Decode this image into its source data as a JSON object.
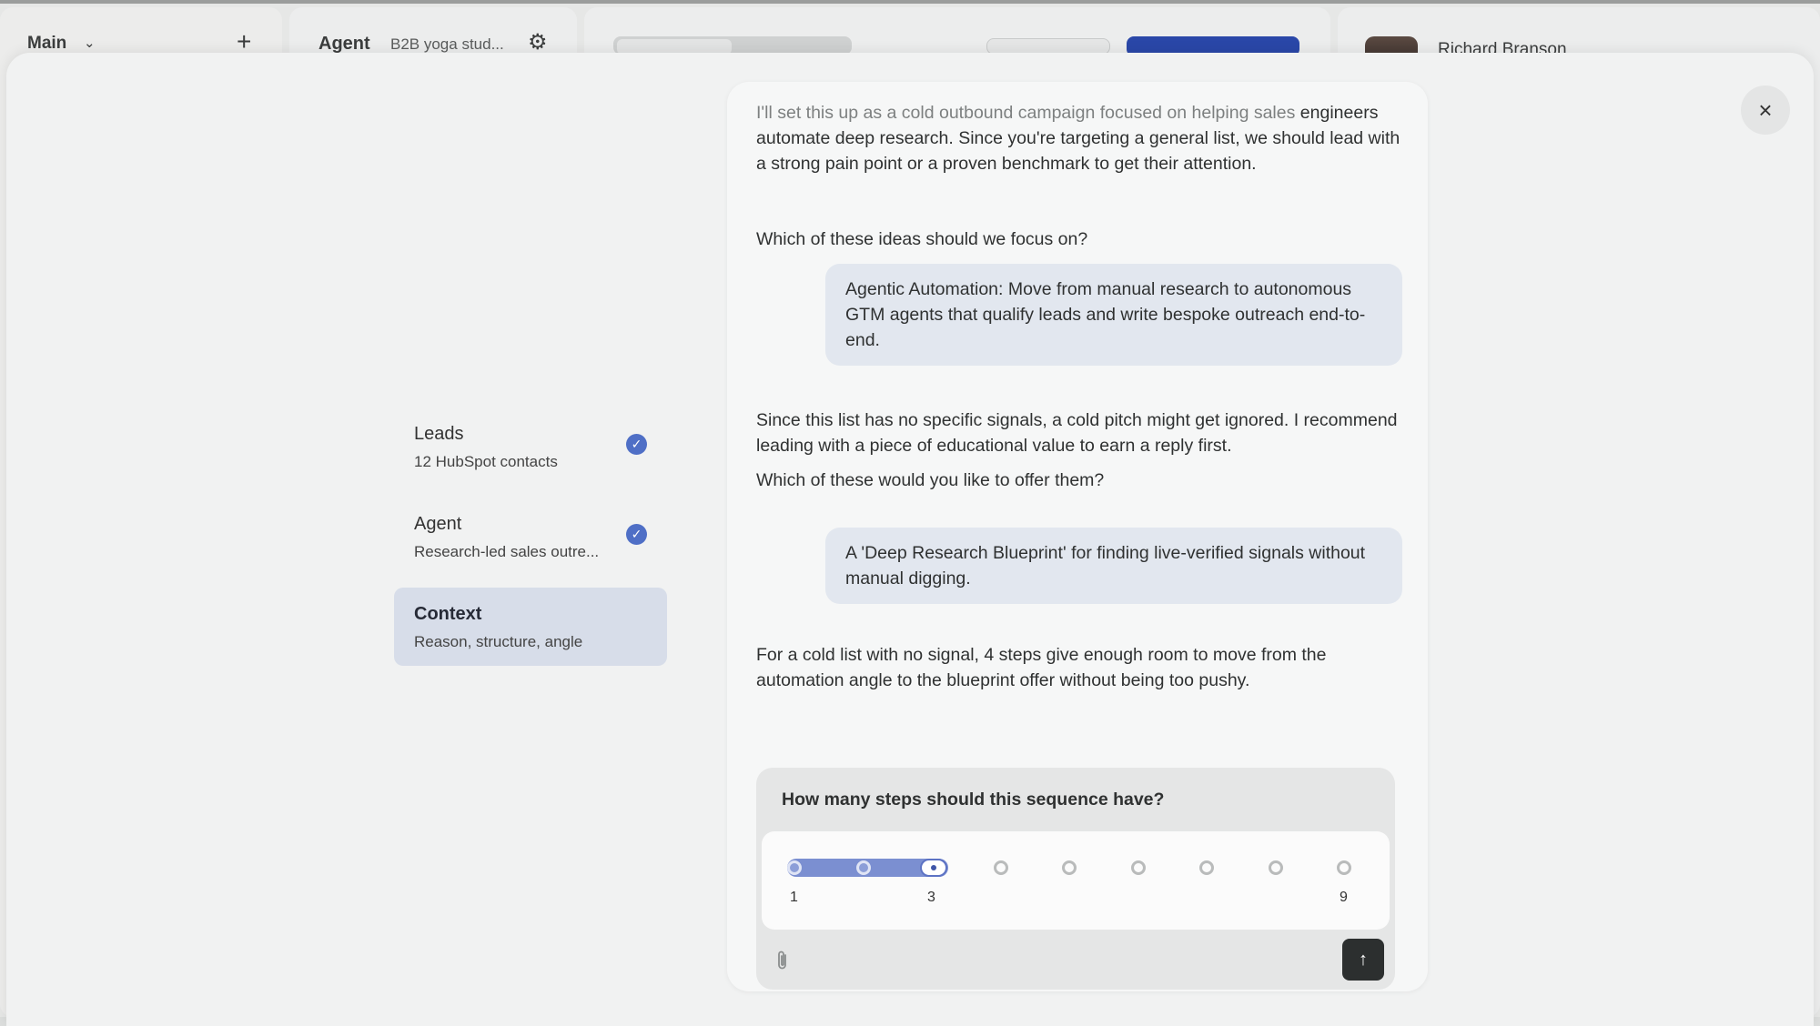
{
  "background": {
    "workspace_label": "Main",
    "agent_label": "Agent",
    "agent_subtitle": "B2B yoga stud...",
    "user_name": "Richard Branson"
  },
  "modal": {
    "close_icon": "×"
  },
  "steps": [
    {
      "title": "Leads",
      "subtitle": "12 HubSpot contacts",
      "done": true
    },
    {
      "title": "Agent",
      "subtitle": "Research-led sales outre...",
      "done": true
    },
    {
      "title": "Context",
      "subtitle": "Reason, structure, angle",
      "done": false,
      "active": true
    }
  ],
  "chat": {
    "msg1_line_faded": "I'll set this up as a cold outbound campaign focused on helping sales",
    "msg1_rest": "engineers automate deep research. Since you're targeting a general list, we should lead with a strong pain point or a proven benchmark to get their attention.",
    "msg1_question": "Which of these ideas should we focus on?",
    "reply1": "Agentic Automation: Move from manual research to autonomous GTM agents that qualify leads and write bespoke outreach end-to-end.",
    "msg2": "Since this list has no specific signals, a cold pitch might get ignored. I recommend leading with a piece of educational value to earn a reply first.",
    "msg2_question": "Which of these would you like to offer them?",
    "reply2": "A 'Deep Research Blueprint' for finding live-verified signals without manual digging.",
    "msg3": "For a cold list with no signal, 4 steps give enough room to move from the automation angle to the blueprint offer without being too pushy."
  },
  "question": {
    "title": "How many steps should this sequence have?",
    "min": 1,
    "max": 9,
    "selected": 3,
    "min_label": "1",
    "selected_label": "3",
    "max_label": "9"
  },
  "icons": {
    "check": "check-icon",
    "close": "close-icon",
    "attach": "paperclip-icon",
    "send": "arrow-up-icon"
  },
  "colors": {
    "accent": "#4f6fc6",
    "slider_fill": "#7b8fd1",
    "send_button": "#2c2f2f"
  }
}
